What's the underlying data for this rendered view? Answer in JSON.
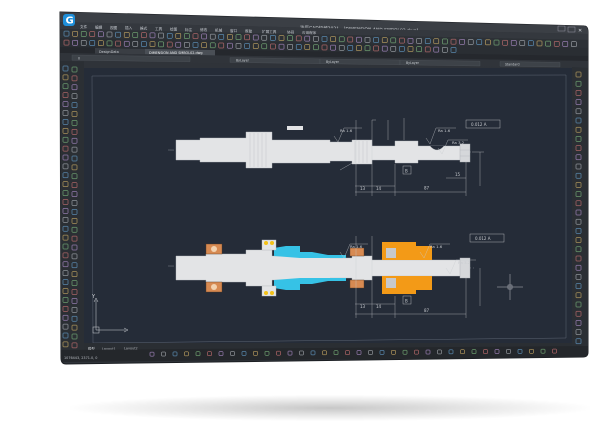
{
  "app": {
    "title": "浩辰CAD机械2021 - [DIMENSION AND SMBOL02.dwg]",
    "logo_letter": "G"
  },
  "menu": [
    "文件",
    "编辑",
    "视图",
    "插入",
    "格式",
    "工具",
    "绘图",
    "标注",
    "修改",
    "机械",
    "窗口",
    "帮助",
    "扩展工具",
    "协同",
    "应用程序"
  ],
  "doc_tabs": [
    "DesignData",
    "DIMENSION AND SMBOL02.dwg"
  ],
  "layer_bar": {
    "layer": "0",
    "color": "ByLayer",
    "linetype": "ByLayer",
    "lineweight": "ByLayer",
    "style": "Standard"
  },
  "annotations": {
    "roughness_16": "Ra 1.6",
    "roughness_32": "Ra 3.2",
    "tolerance": "0.012 A",
    "dim_13": "13",
    "dim_14": "14",
    "dim_87": "87",
    "dim_15": "15",
    "datum": "B"
  },
  "layout_tabs": [
    "模型",
    "Layout1",
    "Layout2"
  ],
  "status": {
    "coords": "1076443, 2371.0, 0"
  },
  "colors": {
    "canvas": "#252c38",
    "part_fill": "#e3e4e6",
    "cyan": "#36c2e6",
    "orange": "#f39a17",
    "bearing": "#d78a52"
  }
}
